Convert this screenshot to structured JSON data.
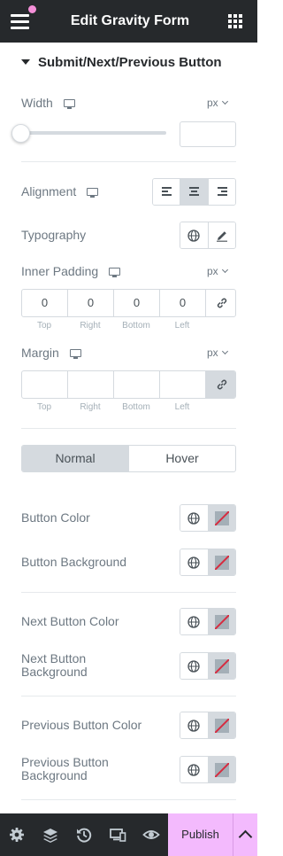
{
  "header": {
    "title": "Edit Gravity Form"
  },
  "section": {
    "title": "Submit/Next/Previous Button"
  },
  "width": {
    "label": "Width",
    "unit": "px",
    "value": ""
  },
  "alignment": {
    "label": "Alignment",
    "selected": "center"
  },
  "typography": {
    "label": "Typography"
  },
  "inner_padding": {
    "label": "Inner Padding",
    "unit": "px",
    "values": [
      "0",
      "0",
      "0",
      "0"
    ],
    "sides": [
      "Top",
      "Right",
      "Bottom",
      "Left"
    ]
  },
  "margin": {
    "label": "Margin",
    "unit": "px",
    "values": [
      "",
      "",
      "",
      ""
    ],
    "sides": [
      "Top",
      "Right",
      "Bottom",
      "Left"
    ]
  },
  "state_tabs": [
    "Normal",
    "Hover"
  ],
  "color_controls": {
    "button_color": "Button Color",
    "button_background": "Button Background",
    "next_button_color": "Next Button Color",
    "next_button_background": "Next Button Background",
    "previous_button_color": "Previous Button Color",
    "previous_button_background": "Previous Button Background"
  },
  "footer": {
    "publish_label": "Publish"
  },
  "icons": {
    "menu": "hamburger-menu-icon",
    "apps": "grid-icon",
    "settings": "gear-icon",
    "layers": "layers-icon",
    "history": "history-icon",
    "responsive": "responsive-icon",
    "preview": "eye-icon"
  },
  "colors": {
    "topbar": "#26292c",
    "publish": "#f3bafd",
    "notification": "#f48fd8"
  }
}
